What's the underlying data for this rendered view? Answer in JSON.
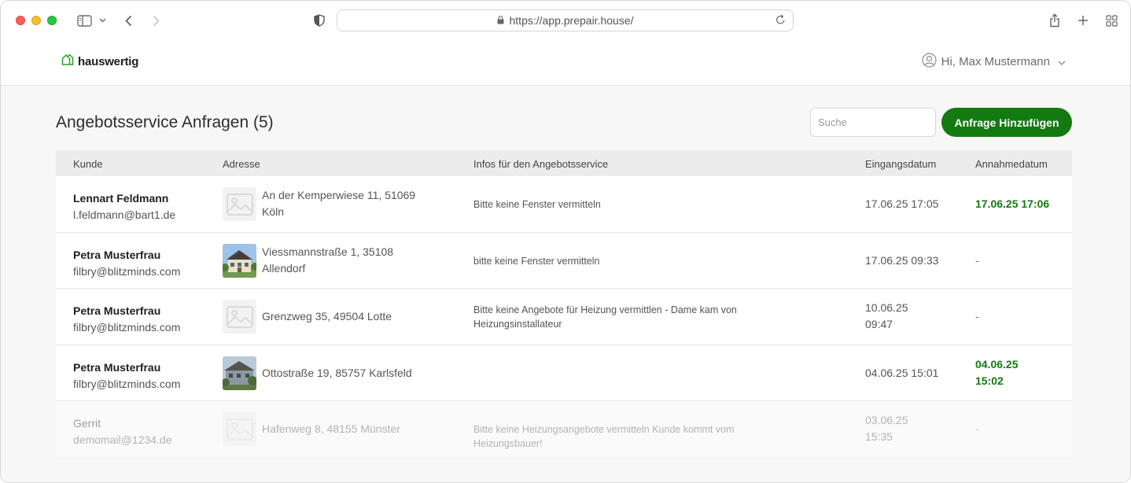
{
  "browser": {
    "url": "https://app.prepair.house/"
  },
  "app": {
    "logo_text": "hauswertig",
    "user_greeting": "Hi, Max Mustermann"
  },
  "page": {
    "title": "Angebotsservice Anfragen (5)",
    "search_placeholder": "Suche",
    "add_button_label": "Anfrage Hinzufügen"
  },
  "colors": {
    "brand_green": "#137a12",
    "header_row_bg": "#ececec"
  },
  "table": {
    "columns": [
      "Kunde",
      "Adresse",
      "Infos für den Angebotsservice",
      "Eingangsdatum",
      "Annahmedatum"
    ],
    "rows": [
      {
        "name": "Lennart Feldmann",
        "email": "l.feldmann@bart1.de",
        "address_line1": "An der Kemperwiese 11, 51069",
        "address_line2": "Köln",
        "thumbnail": "placeholder-image-icon",
        "info_line1": "Bitte keine Fenster vermitteln",
        "info_line2": "",
        "received_line1": "17.06.25 17:05",
        "received_line2": "",
        "accepted_line1": "17.06.25 17:06",
        "accepted_line2": "",
        "accepted_status": "accepted"
      },
      {
        "name": "Petra Musterfrau",
        "email": "filbry@blitzminds.com",
        "address_line1": "Viessmannstraße 1, 35108",
        "address_line2": "Allendorf",
        "thumbnail": "house-photo",
        "info_line1": "bitte keine Fenster vermitteln",
        "info_line2": "",
        "received_line1": "17.06.25 09:33",
        "received_line2": "",
        "accepted_line1": "-",
        "accepted_line2": "",
        "accepted_status": "pending"
      },
      {
        "name": "Petra Musterfrau",
        "email": "filbry@blitzminds.com",
        "address_line1": "Grenzweg 35, 49504 Lotte",
        "address_line2": "",
        "thumbnail": "placeholder-image-icon",
        "info_line1": "Bitte keine Angebote für Heizung vermittlen - Dame kam von",
        "info_line2": "Heizungsinstallateur",
        "received_line1": "10.06.25",
        "received_line2": "09:47",
        "accepted_line1": "-",
        "accepted_line2": "",
        "accepted_status": "pending"
      },
      {
        "name": "Petra Musterfrau",
        "email": "filbry@blitzminds.com",
        "address_line1": "Ottostraße 19, 85757 Karlsfeld",
        "address_line2": "",
        "thumbnail": "house-photo",
        "info_line1": "",
        "info_line2": "",
        "received_line1": "04.06.25 15:01",
        "received_line2": "",
        "accepted_line1": "04.06.25",
        "accepted_line2": "15:02",
        "accepted_status": "accepted"
      },
      {
        "name": "Gerrit",
        "email": "demomail@1234.de",
        "address_line1": "Hafenweg 8, 48155 Münster",
        "address_line2": "",
        "thumbnail": "placeholder-image-icon",
        "info_line1": "Bitte keine Heizungsangebote vermitteln Kunde kommt vom Heizungsbauer!",
        "info_line2": "",
        "received_line1": "03.06.25",
        "received_line2": "15:35",
        "accepted_line1": "-",
        "accepted_line2": "",
        "accepted_status": "pending"
      }
    ]
  }
}
